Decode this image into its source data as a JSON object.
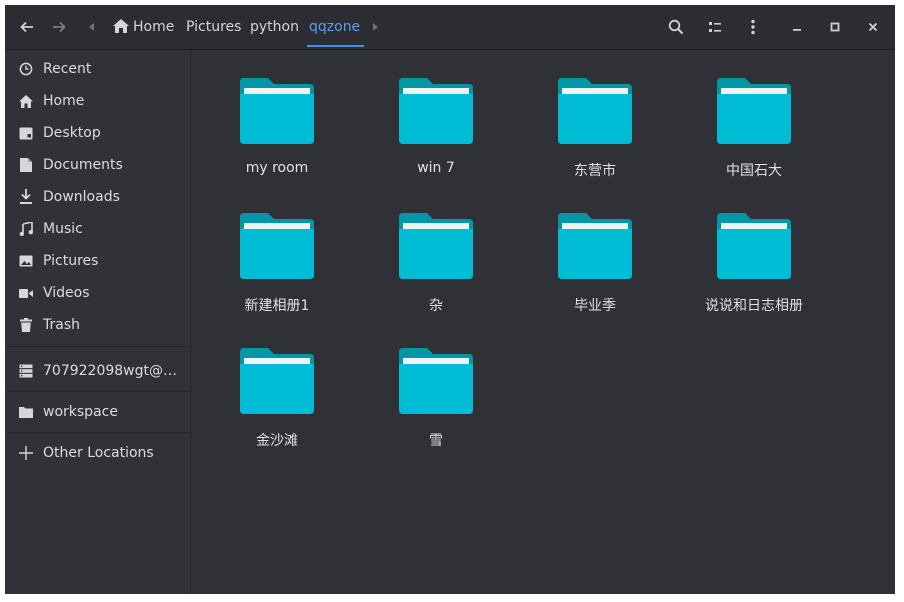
{
  "breadcrumb": {
    "home": "Home",
    "parts": [
      "Pictures",
      "python",
      "qqzone"
    ]
  },
  "sidebar": {
    "places": [
      {
        "label": "Recent",
        "icon": "clock-icon"
      },
      {
        "label": "Home",
        "icon": "home-icon"
      },
      {
        "label": "Desktop",
        "icon": "desktop-icon"
      },
      {
        "label": "Documents",
        "icon": "document-icon"
      },
      {
        "label": "Downloads",
        "icon": "download-icon"
      },
      {
        "label": "Music",
        "icon": "music-icon"
      },
      {
        "label": "Pictures",
        "icon": "image-icon"
      },
      {
        "label": "Videos",
        "icon": "video-icon"
      },
      {
        "label": "Trash",
        "icon": "trash-icon"
      }
    ],
    "network": "707922098wgt@…",
    "bookmark": "workspace",
    "other": "Other Locations"
  },
  "folders": [
    "my room",
    "win 7",
    "东营市",
    "中国石大",
    "新建相册1",
    "杂",
    "毕业季",
    "说说和日志相册",
    "金沙滩",
    "雪"
  ],
  "colors": {
    "folder": "#00bcd4",
    "folder_tab": "#0097a7",
    "accent": "#4a8fe7"
  }
}
